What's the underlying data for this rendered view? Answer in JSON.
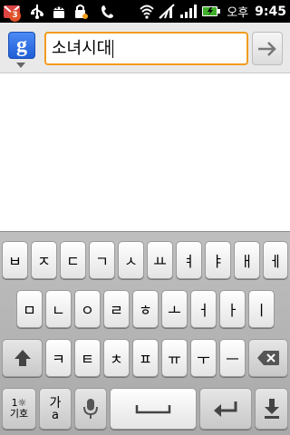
{
  "status_bar": {
    "notification_count": "3",
    "icons": [
      "gmail-notification-icon",
      "usb-icon",
      "android-debug-icon",
      "sim-lock-icon",
      "missed-call-icon",
      "wifi-icon",
      "no-signal-icon",
      "signal-icon",
      "battery-charging-icon"
    ],
    "carrier": "오후",
    "time": "9:45"
  },
  "search": {
    "engine_icon": "google-icon",
    "engine_letter": "g",
    "query": "소녀시대",
    "submit_icon": "arrow-right-icon"
  },
  "keyboard": {
    "row1": [
      "ㅂ",
      "ㅈ",
      "ㄷ",
      "ㄱ",
      "ㅅ",
      "ㅛ",
      "ㅕ",
      "ㅑ",
      "ㅐ",
      "ㅔ"
    ],
    "row2": [
      "ㅁ",
      "ㄴ",
      "ㅇ",
      "ㄹ",
      "ㅎ",
      "ㅗ",
      "ㅓ",
      "ㅏ",
      "ㅣ"
    ],
    "row3": [
      "ㅋ",
      "ㅌ",
      "ㅊ",
      "ㅍ",
      "ㅠ",
      "ㅜ",
      "ㅡ"
    ],
    "symbols_key": {
      "top": "1☼",
      "bottom": "기호"
    },
    "lang_key": {
      "top": "가",
      "bottom": "a"
    },
    "shift_icon": "shift-arrow-icon",
    "backspace_icon": "backspace-icon",
    "mic_icon": "microphone-icon",
    "space_icon": "space-bar-icon",
    "enter_icon": "enter-arrow-icon",
    "hide_icon": "hide-keyboard-icon"
  }
}
